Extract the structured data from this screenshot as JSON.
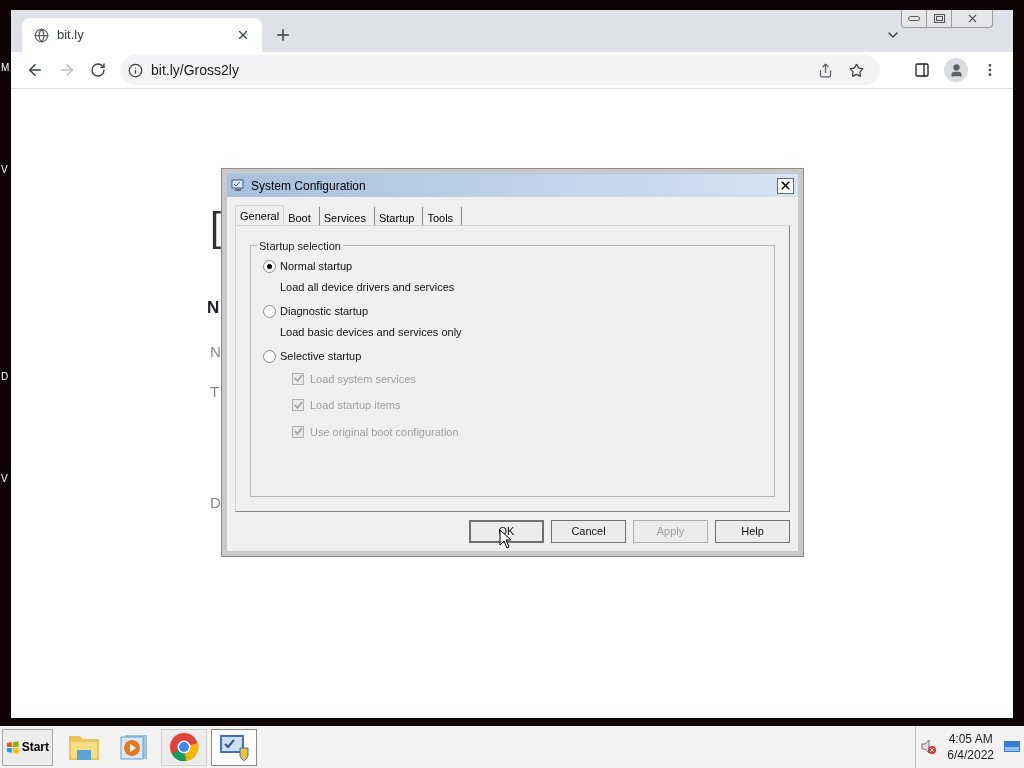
{
  "desktop_labels": [
    "M",
    "V",
    "D",
    "V"
  ],
  "browser": {
    "tabs": [
      {
        "title": "bit.ly",
        "selected": true
      }
    ],
    "url": "bit.ly/Gross2ly"
  },
  "page_fragments": [
    {
      "text": "[",
      "kind": "bracket"
    },
    {
      "text": "N",
      "kind": "heading"
    },
    {
      "text": "N",
      "kind": "text"
    },
    {
      "text": "T",
      "kind": "text"
    },
    {
      "text": "D",
      "kind": "text"
    }
  ],
  "dialog": {
    "title": "System Configuration",
    "tabs": [
      {
        "label": "General",
        "selected": true
      },
      {
        "label": "Boot",
        "selected": false
      },
      {
        "label": "Services",
        "selected": false
      },
      {
        "label": "Startup",
        "selected": false
      },
      {
        "label": "Tools",
        "selected": false
      }
    ],
    "group_title": "Startup selection",
    "options": [
      {
        "label": "Normal startup",
        "description": "Load all device drivers and services",
        "selected": true
      },
      {
        "label": "Diagnostic startup",
        "description": "Load basic devices and services only",
        "selected": false
      },
      {
        "label": "Selective startup",
        "selected": false
      }
    ],
    "sub_options": [
      {
        "label": "Load system services",
        "checked": true,
        "disabled": true
      },
      {
        "label": "Load startup items",
        "checked": true,
        "disabled": true
      },
      {
        "label": "Use original boot configuration",
        "checked": true,
        "disabled": true
      }
    ],
    "buttons": [
      {
        "label": "OK",
        "disabled": false
      },
      {
        "label": "Cancel",
        "disabled": false
      },
      {
        "label": "Apply",
        "disabled": true
      },
      {
        "label": "Help",
        "disabled": false
      }
    ]
  },
  "taskbar": {
    "start": "Start",
    "apps": [
      {
        "kind": "folder",
        "selected": false
      },
      {
        "kind": "media",
        "selected": false
      },
      {
        "kind": "chrome",
        "selected": false
      },
      {
        "kind": "msconfig",
        "selected": true
      }
    ],
    "time": "4:05 AM",
    "date": "6/4/2022"
  }
}
